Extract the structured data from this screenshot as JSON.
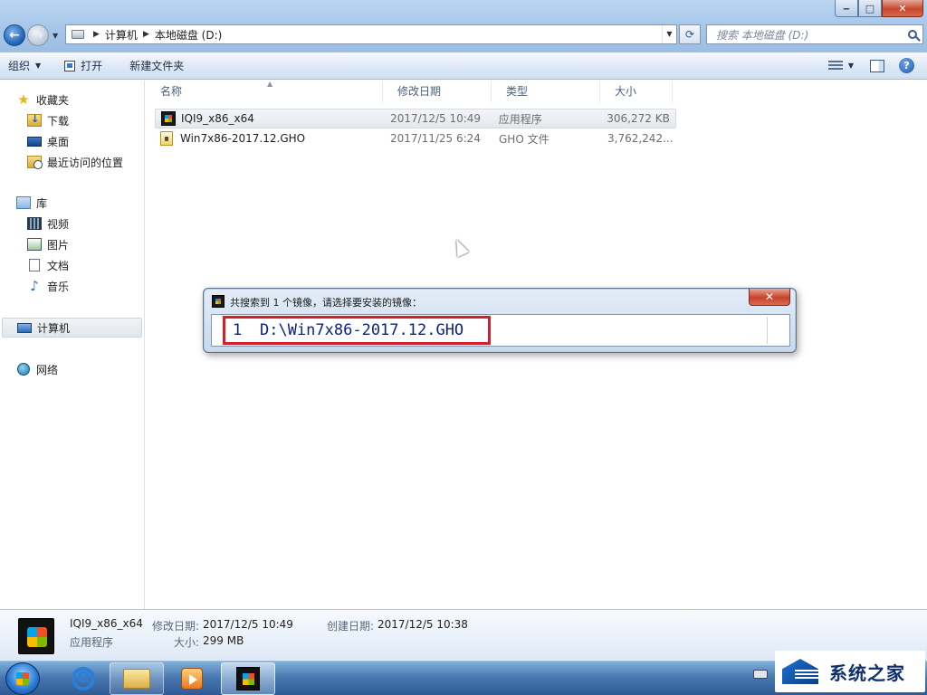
{
  "window": {
    "controls": {
      "minimize": "‒",
      "maximize": "□",
      "close": "✕"
    }
  },
  "address_bar": {
    "breadcrumbs": [
      "计算机",
      "本地磁盘 (D:)"
    ],
    "search_placeholder": "搜索 本地磁盘 (D:)"
  },
  "toolbar": {
    "organize": "组织",
    "open": "打开",
    "new_folder": "新建文件夹"
  },
  "nav_pane": {
    "favorites": {
      "label": "收藏夹",
      "items": [
        "下载",
        "桌面",
        "最近访问的位置"
      ]
    },
    "libraries": {
      "label": "库",
      "items": [
        "视频",
        "图片",
        "文档",
        "音乐"
      ]
    },
    "computer": "计算机",
    "network": "网络"
  },
  "file_list": {
    "columns": [
      "名称",
      "修改日期",
      "类型",
      "大小"
    ],
    "rows": [
      {
        "name": "IQI9_x86_x64",
        "modified": "2017/12/5 10:49",
        "type": "应用程序",
        "size": "306,272 KB",
        "icon": "app-icon",
        "selected": true
      },
      {
        "name": "Win7x86-2017.12.GHO",
        "modified": "2017/11/25 6:24",
        "type": "GHO 文件",
        "size": "3,762,242...",
        "icon": "gho-file-icon",
        "selected": false
      }
    ]
  },
  "dialog": {
    "title": "共搜索到 1 个镜像，请选择要安装的镜像：",
    "close_label": "✕",
    "items": [
      {
        "index": "1",
        "path": "D:\\Win7x86-2017.12.GHO"
      }
    ],
    "highlight_color": "#d21f2a"
  },
  "details_pane": {
    "name": "IQI9_x86_x64",
    "type": "应用程序",
    "modified_label": "修改日期:",
    "modified_value": "2017/12/5 10:49",
    "created_label": "创建日期:",
    "created_value": "2017/12/5 10:38",
    "size_label": "大小:",
    "size_value": "299 MB"
  },
  "taskbar": {
    "buttons": [
      "start-button",
      "internet-explorer",
      "windows-explorer",
      "media-player",
      "ghost-installer"
    ]
  },
  "watermark": {
    "text": "系统之家"
  }
}
